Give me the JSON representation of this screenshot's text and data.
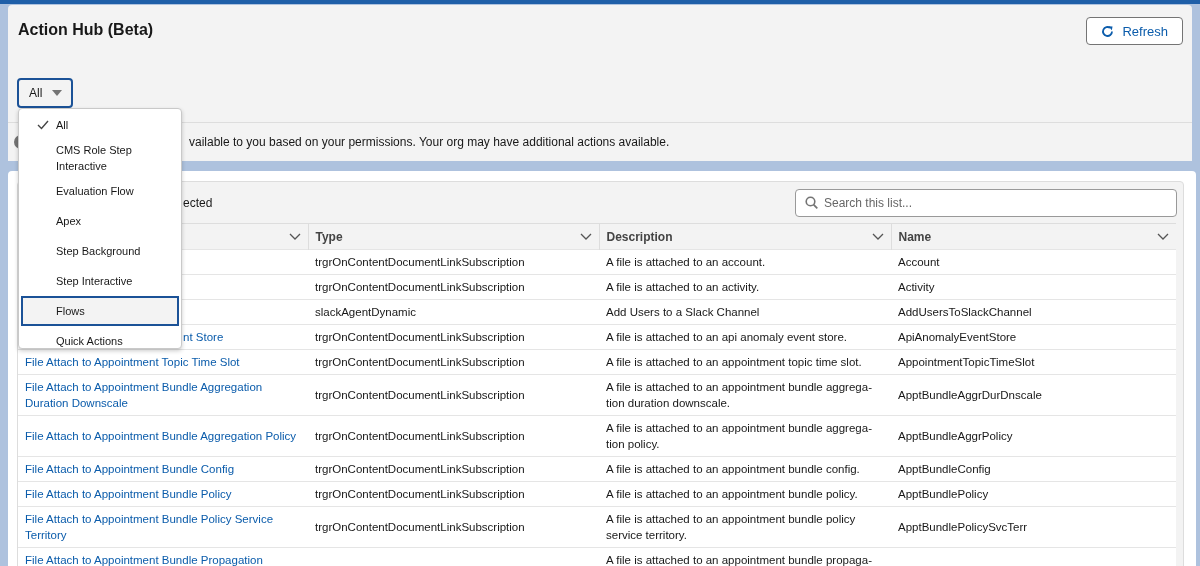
{
  "page": {
    "title": "Action Hub (Beta)",
    "refresh_button": "Refresh"
  },
  "filter": {
    "value": "All",
    "options": [
      {
        "label": "All",
        "checked": true,
        "highlighted": false
      },
      {
        "label": "CMS Role Step Interactive",
        "checked": false,
        "highlighted": false
      },
      {
        "label": "Evaluation Flow",
        "checked": false,
        "highlighted": false
      },
      {
        "label": "Apex",
        "checked": false,
        "highlighted": false
      },
      {
        "label": "Step Background",
        "checked": false,
        "highlighted": false
      },
      {
        "label": "Step Interactive",
        "checked": false,
        "highlighted": false
      },
      {
        "label": "Flows",
        "checked": false,
        "highlighted": true
      },
      {
        "label": "Quick Actions",
        "checked": false,
        "highlighted": false
      }
    ]
  },
  "info_bar": {
    "text": "vailable to you based on your permissions. Your org may have additional actions available."
  },
  "list": {
    "selection_text": "ected",
    "search": {
      "placeholder": "Search this list..."
    },
    "columns": [
      {},
      {
        "label": "Type"
      },
      {
        "label": "Description"
      },
      {
        "label": "Name"
      }
    ],
    "rows": [
      {
        "type": "trgrOnContentDocumentLinkSubscription",
        "description": "A file is attached to an account.",
        "name": "Account"
      },
      {
        "type": "trgrOnContentDocumentLinkSubscription",
        "description": "A file is attached to an activity.",
        "name": "Activity"
      },
      {
        "type": "slackAgentDynamic",
        "description": "Add Users to a Slack Channel",
        "name": "AddUsersToSlackChannel"
      },
      {
        "label": "nt Store",
        "label_clipped": true,
        "type": "trgrOnContentDocumentLinkSubscription",
        "description": "A file is attached to an api anomaly event store.",
        "name": "ApiAnomalyEventStore"
      },
      {
        "label": "File Attach to Appointment Topic Time Slot",
        "label_clipped": false,
        "type": "trgrOnContentDocumentLinkSubscription",
        "description": "A file is attached to an appointment topic time slot.",
        "name": "AppointmentTopicTimeSlot"
      },
      {
        "label": "File Attach to Appointment Bundle Aggregation Duration Downscale",
        "label_clipped": false,
        "type": "trgrOnContentDocumentLinkSubscription",
        "description": "A file is attached to an appointment bundle aggrega-tion duration downscale.",
        "name": "ApptBundleAggrDurDnscale"
      },
      {
        "label": "File Attach to Appointment Bundle Aggregation Policy",
        "label_clipped": false,
        "type": "trgrOnContentDocumentLinkSubscription",
        "description": "A file is attached to an appointment bundle aggrega-tion policy.",
        "name": "ApptBundleAggrPolicy"
      },
      {
        "label": "File Attach to Appointment Bundle Config",
        "label_clipped": false,
        "type": "trgrOnContentDocumentLinkSubscription",
        "description": "A file is attached to an appointment bundle config.",
        "name": "ApptBundleConfig"
      },
      {
        "label": "File Attach to Appointment Bundle Policy",
        "label_clipped": false,
        "type": "trgrOnContentDocumentLinkSubscription",
        "description": "A file is attached to an appointment bundle policy.",
        "name": "ApptBundlePolicy"
      },
      {
        "label": "File Attach to Appointment Bundle Policy Service Territory",
        "label_clipped": false,
        "type": "trgrOnContentDocumentLinkSubscription",
        "description": "A file is attached to an appointment bundle policy service territory.",
        "name": "ApptBundlePolicySvcTerr"
      },
      {
        "label": "File Attach to Appointment Bundle Propagation",
        "label_clipped": false,
        "description": "A file is attached to an appointment bundle propaga-"
      }
    ]
  }
}
